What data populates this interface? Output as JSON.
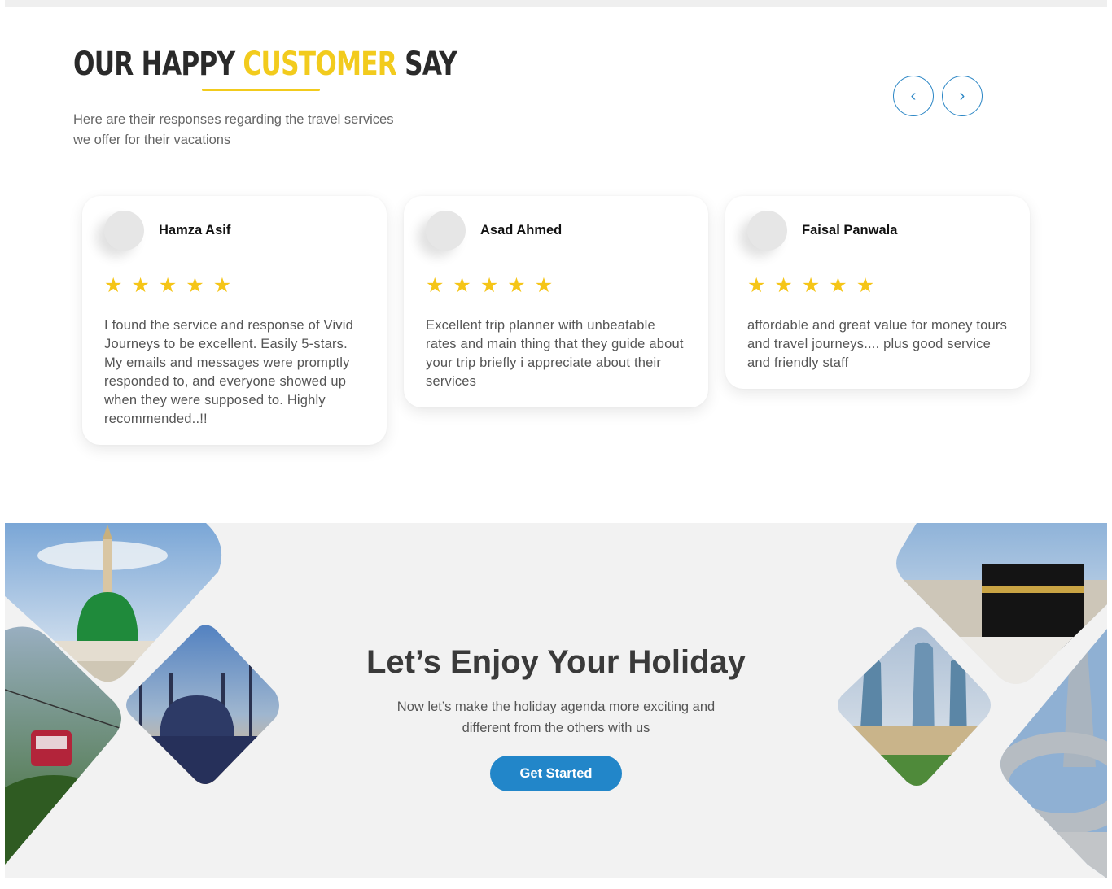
{
  "testimonials": {
    "title_part1": "OUR HAPPY ",
    "title_accent": "CUSTOMER",
    "title_part2": " SAY",
    "subtitle": "Here are their responses regarding the travel services we offer for their vacations",
    "prev_label": "‹",
    "next_label": "›",
    "cards": [
      {
        "name": "Hamza Asif",
        "rating": 5,
        "text": "I found the service and response of Vivid Journeys to be excellent. Easily 5-stars. My emails and messages were promptly responded to, and everyone showed up when they were supposed to. Highly recommended..!!"
      },
      {
        "name": "Asad Ahmed",
        "rating": 5,
        "text": "Excellent trip planner with unbeatable rates and main thing that they guide about your trip briefly i appreciate about their services"
      },
      {
        "name": "Faisal Panwala",
        "rating": 5,
        "text": "affordable and great value for money tours and travel journeys.... plus good service and friendly staff"
      }
    ]
  },
  "banner": {
    "title": "Let’s Enjoy Your Holiday",
    "subtitle": "Now let’s make the holiday agenda more exciting and different from the others with us",
    "cta_label": "Get Started"
  },
  "colors": {
    "accent_yellow": "#f2cb1d",
    "brand_blue": "#2286c9",
    "star": "#f5c518"
  },
  "icons": {
    "star": "star-icon",
    "prev": "chevron-left-icon",
    "next": "chevron-right-icon"
  }
}
